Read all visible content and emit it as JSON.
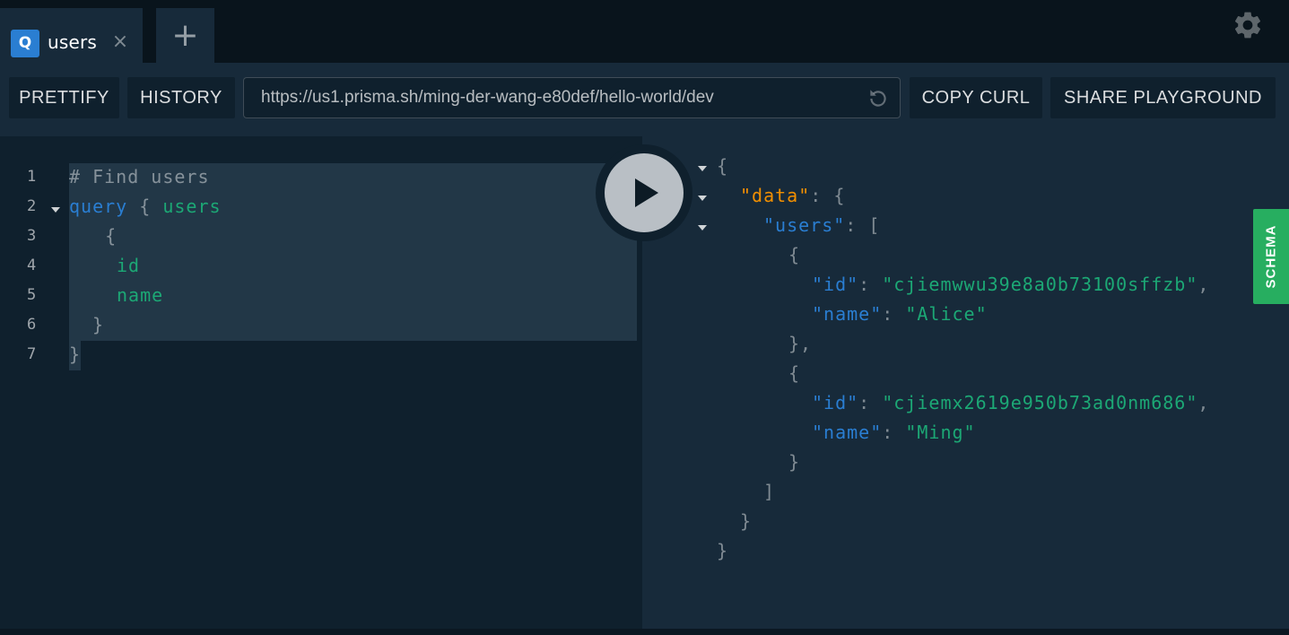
{
  "tab": {
    "badge": "Q",
    "name": "users",
    "close_glyph": "×",
    "new_glyph": "+"
  },
  "toolbar": {
    "prettify_label": "PRETTIFY",
    "history_label": "HISTORY",
    "endpoint_url": "https://us1.prisma.sh/ming-der-wang-e80def/hello-world/dev",
    "copy_curl_label": "COPY CURL",
    "share_label": "SHARE PLAYGROUND"
  },
  "editor": {
    "line_numbers": [
      "1",
      "2",
      "3",
      "4",
      "5",
      "6",
      "7"
    ],
    "lines": {
      "l1_comment": "# Find users",
      "l2_kw": "query",
      "l2_brace": " { ",
      "l2_field": "users",
      "l3": "  {",
      "l4": "id",
      "l5": "name",
      "l6": "}",
      "l7": "}"
    }
  },
  "result": {
    "open": "{",
    "data_key": "\"data\"",
    "users_key": "\"users\"",
    "colon_brace": ": {",
    "colon_bracket": ": [",
    "users": [
      {
        "id_key": "\"id\"",
        "id_val": "\"cjiemwwu39e8a0b73100sffzb\"",
        "name_key": "\"name\"",
        "name_val": "\"Alice\""
      },
      {
        "id_key": "\"id\"",
        "id_val": "\"cjiemx2619e950b73ad0nm686\"",
        "name_key": "\"name\"",
        "name_val": "\"Ming\""
      }
    ],
    "close_bracket": "]",
    "close_brace": "}",
    "obj_close_comma": "},"
  },
  "schema_tab": {
    "label": "SCHEMA",
    "color": "#27ae60"
  },
  "icons": {
    "settings": "gear-icon",
    "reload": "reload-icon",
    "run": "play-icon"
  }
}
